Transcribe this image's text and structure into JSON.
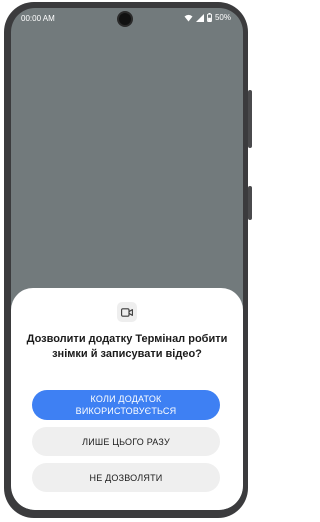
{
  "status": {
    "time": "00:00 AM",
    "battery": "50%"
  },
  "dialog": {
    "icon": "video-camera-icon",
    "title": "Дозволити додатку Термінал робити знімки й записувати відео?",
    "buttons": {
      "while_using": "КОЛИ ДОДАТОК ВИКОРИСТОВУЄТЬСЯ",
      "only_this_time": "ЛИШЕ ЦЬОГО РАЗУ",
      "deny": "НЕ ДОЗВОЛЯТИ"
    }
  },
  "colors": {
    "accent": "#3e80f3",
    "screen_dim": "#727a7c",
    "secondary_button": "#efefef"
  }
}
